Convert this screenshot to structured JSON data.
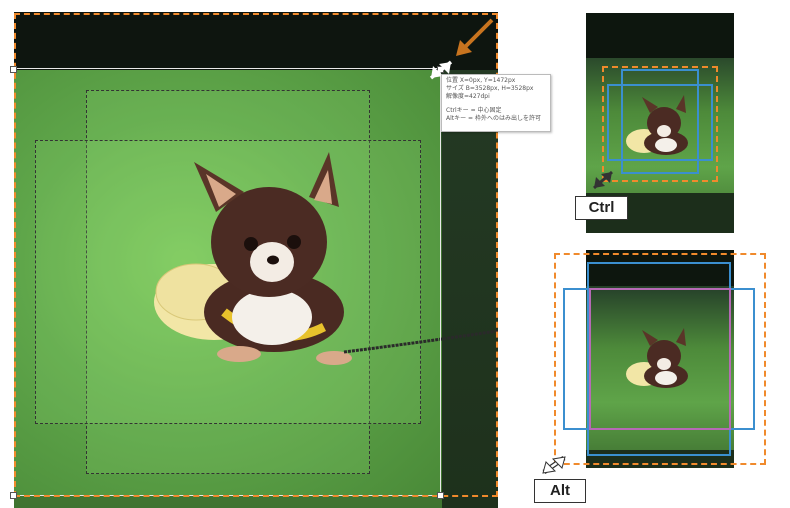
{
  "tooltip": {
    "line1": "位置 X=0px, Y=1472px",
    "line2": "サイズ B=3528px, H=3528px",
    "line3": "解像度=427dpi",
    "line4": "Ctrlキー = 中心固定",
    "line5": "Altキー = 枠外へのはみ出しを許可"
  },
  "labels": {
    "ctrl": "Ctrl",
    "alt": "Alt"
  },
  "icons": {
    "resize": "diagonal-resize-arrow-icon",
    "pointer": "orange-pointer-arrow-icon"
  },
  "colors": {
    "orange_guide": "#f08a2c",
    "blue_guide": "#3b8fcf",
    "purple_guide": "#b66ab5",
    "background": "#ffffff"
  }
}
